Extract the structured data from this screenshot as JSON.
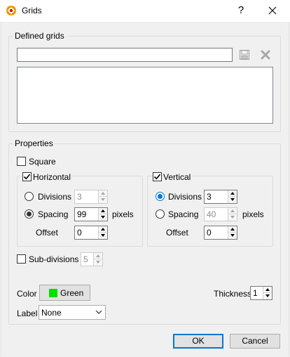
{
  "window": {
    "title": "Grids",
    "help_glyph": "?"
  },
  "defined_grids": {
    "title": "Defined grids",
    "name_value": "",
    "list_items": []
  },
  "properties": {
    "title": "Properties",
    "square_label": "Square",
    "square_checked": false,
    "horizontal": {
      "title": "Horizontal",
      "checked": true,
      "divisions_label": "Divisions",
      "divisions_value": "3",
      "spacing_label": "Spacing",
      "spacing_value": "99",
      "pixels_label": "pixels",
      "offset_label": "Offset",
      "offset_value": "0",
      "selected": "spacing"
    },
    "vertical": {
      "title": "Vertical",
      "checked": true,
      "divisions_label": "Divisions",
      "divisions_value": "3",
      "spacing_label": "Spacing",
      "spacing_value": "40",
      "pixels_label": "pixels",
      "offset_label": "Offset",
      "offset_value": "0",
      "selected": "divisions"
    },
    "subdivisions_label": "Sub-divisions",
    "subdivisions_checked": false,
    "subdivisions_value": "5",
    "color_label": "Color",
    "color_button_label": "Green",
    "color_swatch": "#00e000",
    "thickness_label": "Thickness",
    "thickness_value": "1",
    "label_label": "Label",
    "label_value": "None"
  },
  "buttons": {
    "ok": "OK",
    "cancel": "Cancel"
  },
  "colors": {
    "accent": "#0078d7",
    "disabled_text": "#8a8a8a"
  },
  "icons": {
    "app": "grid-app-icon",
    "save": "save-icon",
    "delete": "delete-x-icon",
    "close": "close-icon"
  }
}
